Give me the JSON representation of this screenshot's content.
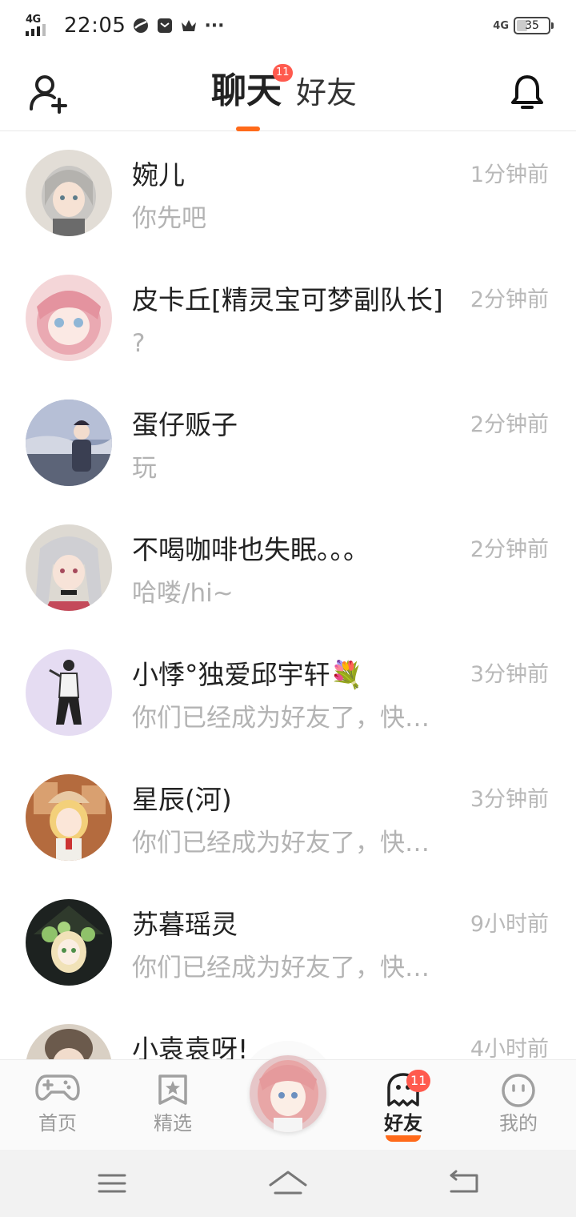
{
  "status_bar": {
    "network": "4G",
    "time": "22:05",
    "more": "···",
    "signal_right": "4G",
    "battery": "35",
    "icons": [
      "browser-icon",
      "message-icon",
      "crown-icon"
    ]
  },
  "header": {
    "tabs": [
      {
        "label": "聊天",
        "badge": "11",
        "active": true
      },
      {
        "label": "好友",
        "active": false
      }
    ],
    "accent": "#ff6a1a",
    "badge_color": "#ff5a4e"
  },
  "chats": [
    {
      "name": "婉儿",
      "message": "你先吧",
      "time": "1分钟前",
      "avatar": "silver-hair-girl-avatar"
    },
    {
      "name": "皮卡丘[精灵宝可梦副队长]",
      "message": "?",
      "time": "2分钟前",
      "avatar": "pink-hair-girl-avatar"
    },
    {
      "name": "蛋仔贩子",
      "message": "玩",
      "time": "2分钟前",
      "avatar": "boy-seaside-avatar"
    },
    {
      "name": "不喝咖啡也失眠。。。",
      "message": "哈喽/hi~",
      "time": "2分钟前",
      "avatar": "white-twin-tails-avatar"
    },
    {
      "name": "小悸°独爱邱宇轩💐",
      "message": "你们已经成为好友了，快来聊天吧",
      "time": "3分钟前",
      "avatar": "fashion-figure-avatar"
    },
    {
      "name": "星辰(河)",
      "message": "你们已经成为好友了，快来聊天吧",
      "time": "3分钟前",
      "avatar": "blonde-hat-girl-avatar"
    },
    {
      "name": "苏暮瑶灵",
      "message": "你们已经成为好友了，快来聊天吧",
      "time": "9小时前",
      "avatar": "witch-flower-avatar"
    },
    {
      "name": "小袁袁呀!",
      "message": "",
      "time": "4小时前",
      "avatar": "brown-hair-avatar"
    }
  ],
  "bottom_nav": {
    "items": [
      {
        "label": "首页",
        "icon": "gamepad-icon"
      },
      {
        "label": "精选",
        "icon": "star-bookmark-icon"
      },
      {
        "label": "好友",
        "icon": "ghost-icon",
        "badge": "11",
        "active": true
      },
      {
        "label": "我的",
        "icon": "smiley-icon"
      }
    ],
    "center": "profile-avatar"
  },
  "system_nav": [
    "menu-icon",
    "home-icon",
    "back-icon"
  ]
}
